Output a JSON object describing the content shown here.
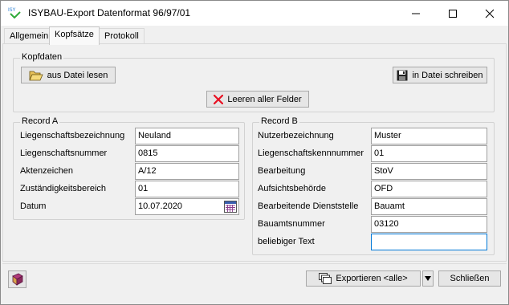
{
  "window": {
    "title": "ISYBAU-Export Datenformat 96/97/01",
    "app_icon_text": "ISY"
  },
  "tabs": [
    {
      "label": "Allgemein"
    },
    {
      "label": "Kopfsätze",
      "active": true
    },
    {
      "label": "Protokoll"
    }
  ],
  "kopfdaten": {
    "group_label": "Kopfdaten",
    "read_file_label": "aus Datei lesen",
    "write_file_label": "in Datei schreiben",
    "clear_all_label": "Leeren aller Felder"
  },
  "record_a": {
    "group_label": "Record A",
    "fields": [
      {
        "label": "Liegenschaftsbezeichnung",
        "value": "Neuland"
      },
      {
        "label": "Liegenschaftsnummer",
        "value": "0815"
      },
      {
        "label": "Aktenzeichen",
        "value": "A/12"
      },
      {
        "label": "Zuständigkeitsbereich",
        "value": "01"
      },
      {
        "label": "Datum",
        "value": "10.07.2020"
      }
    ]
  },
  "record_b": {
    "group_label": "Record B",
    "fields": [
      {
        "label": "Nutzerbezeichnung",
        "value": "Muster"
      },
      {
        "label": "Liegenschaftskennnummer",
        "value": "01"
      },
      {
        "label": "Bearbeitung",
        "value": "StoV"
      },
      {
        "label": "Aufsichtsbehörde",
        "value": "OFD"
      },
      {
        "label": "Bearbeitende Dienststelle",
        "value": "Bauamt"
      },
      {
        "label": "Bauamtsnummer",
        "value": "03120"
      },
      {
        "label": "beliebiger Text",
        "value": ""
      }
    ]
  },
  "footer": {
    "export_label": "Exportieren <alle>",
    "close_label": "Schließen"
  },
  "colors": {
    "accent": "#0078d7",
    "clear_icon": "#e81123"
  }
}
